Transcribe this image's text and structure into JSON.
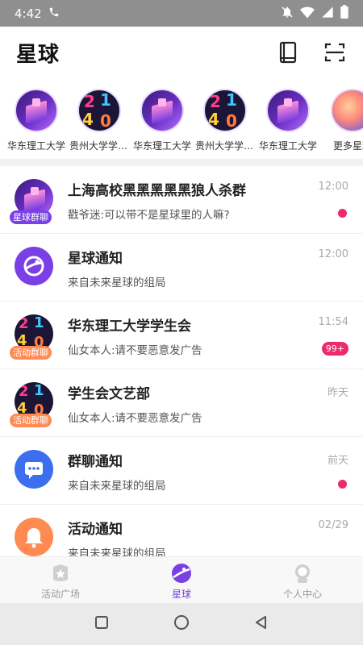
{
  "status": {
    "time": "4:42"
  },
  "header": {
    "title": "星球"
  },
  "circles": [
    {
      "label": "华东理工大学",
      "style": "purple"
    },
    {
      "label": "贵州大学学生会",
      "style": "num"
    },
    {
      "label": "华东理工大学",
      "style": "purple"
    },
    {
      "label": "贵州大学学生会",
      "style": "num"
    },
    {
      "label": "华东理工大学",
      "style": "purple"
    },
    {
      "label": "更多星球",
      "style": "orb"
    }
  ],
  "conversations": [
    {
      "name": "上海高校黑黑黑黑黑狼人杀群",
      "time": "12:00",
      "message": "戳爷迷:可以带不是星球里的人嘛?",
      "tag": "星球群聊",
      "tag_color": "#7a3fe6",
      "indicator": "dot"
    },
    {
      "name": "星球通知",
      "time": "12:00",
      "message": "来自未来星球的组局",
      "icon": "planet",
      "indicator": ""
    },
    {
      "name": "华东理工大学学生会",
      "time": "11:54",
      "message": "仙女本人:请不要恶意发广告",
      "tag": "活动群聊",
      "tag_color": "#ff8a52",
      "indicator": "badge",
      "badge": "99+"
    },
    {
      "name": "学生会文艺部",
      "time": "昨天",
      "message": "仙女本人:请不要恶意发广告",
      "tag": "活动群聊",
      "tag_color": "#ff8a52",
      "indicator": ""
    },
    {
      "name": "群聊通知",
      "time": "前天",
      "message": "来自未来星球的组局",
      "icon": "chat",
      "indicator": "dot"
    },
    {
      "name": "活动通知",
      "time": "02/29",
      "message": "来自未来星球的组局",
      "icon": "bell",
      "indicator": ""
    }
  ],
  "tabs": [
    {
      "label": "活动广场",
      "active": false
    },
    {
      "label": "星球",
      "active": true
    },
    {
      "label": "个人中心",
      "active": false
    }
  ],
  "colors": {
    "accent": "#7a3fe6",
    "badge": "#ee2a6b",
    "orange": "#ff8a52",
    "blue": "#3b6ff0"
  }
}
